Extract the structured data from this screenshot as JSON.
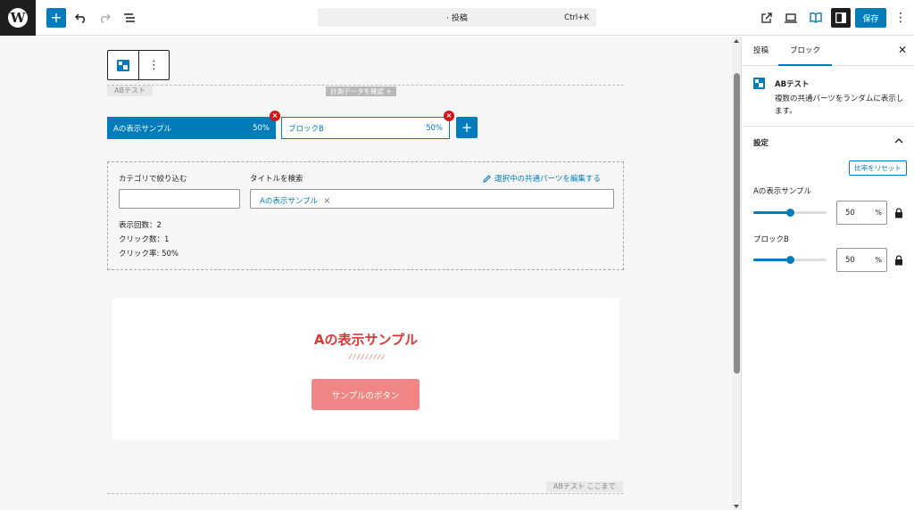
{
  "topbar": {
    "logo_glyph": "W",
    "add_glyph": "+",
    "command_title": "· 投稿",
    "command_shortcut": "Ctrl+K",
    "save_label": "保存",
    "more_glyph": "⋮"
  },
  "block_toolbar": {
    "more_glyph": "⋮"
  },
  "canvas": {
    "ab_label": "ABテスト",
    "measure_label": "計測データを確認 +",
    "tabs": [
      {
        "label": "Aの表示サンプル",
        "percent": "50%"
      },
      {
        "label": "ブロックB",
        "percent": "50%"
      }
    ],
    "tab_close_glyph": "×",
    "tab_add_glyph": "+",
    "filter_label": "カテゴリで絞り込む",
    "filter_value": "",
    "search_label": "タイトルを検索",
    "edit_link": "選択中の共通パーツを編集する",
    "selected_tag": "Aの表示サンプル",
    "tag_remove_glyph": "×",
    "stats": {
      "views": "表示回数：2",
      "clicks": "クリック数：1",
      "ctr": "クリック率: 50%"
    },
    "preview_title": "Aの表示サンプル",
    "preview_button": "サンプルのボタン",
    "ab_end_label": "ABテスト ここまで"
  },
  "sidebar": {
    "tabs": [
      "投稿",
      "ブロック"
    ],
    "active_tab": 1,
    "close_glyph": "✕",
    "block_title": "ABテスト",
    "block_desc": "複数の共通パーツをランダムに表示します。",
    "settings_label": "設定",
    "reset_label": "比率をリセット",
    "sliders": [
      {
        "label": "Aの表示サンプル",
        "value": "50",
        "unit": "%",
        "fraction": 0.5
      },
      {
        "label": "ブロックB",
        "value": "50",
        "unit": "%",
        "fraction": 0.5
      }
    ]
  },
  "colors": {
    "accent": "#007cba",
    "danger": "#cc1818",
    "preview_title": "#d43a3a",
    "preview_button": "#f28585"
  }
}
